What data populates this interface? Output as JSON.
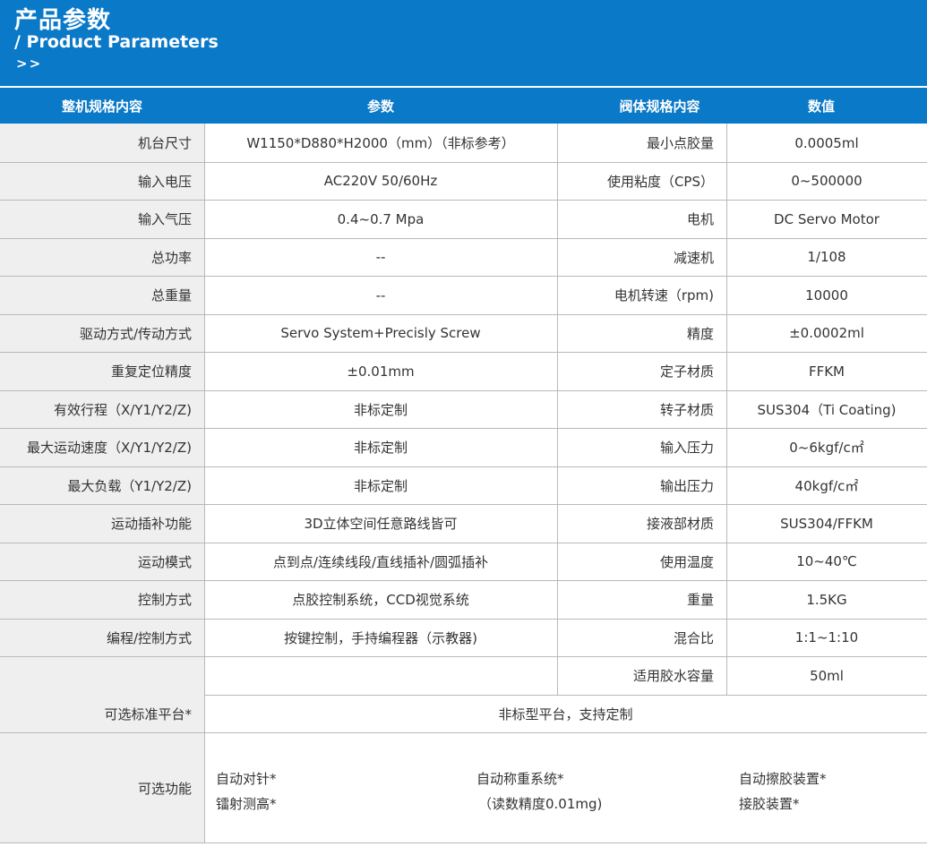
{
  "header": {
    "title_zh": "产品参数",
    "title_en": "/ Product Parameters",
    "arrows": ">>"
  },
  "table_header": {
    "col1": "整机规格内容",
    "col2": "参数",
    "col3": "阀体规格内容",
    "col4": "数值"
  },
  "rows": [
    {
      "label": "机台尺寸",
      "value": "W1150*D880*H2000（mm）（非标参考）",
      "valve_label": "最小点胶量",
      "valve_value": "0.0005ml"
    },
    {
      "label": "输入电压",
      "value": "AC220V 50/60Hz",
      "valve_label": "使用粘度（CPS）",
      "valve_value": "0~500000"
    },
    {
      "label": "输入气压",
      "value": "0.4~0.7 Mpa",
      "valve_label": "电机",
      "valve_value": "DC Servo Motor"
    },
    {
      "label": "总功率",
      "value": "--",
      "valve_label": "减速机",
      "valve_value": "1/108"
    },
    {
      "label": "总重量",
      "value": "--",
      "valve_label": "电机转速（rpm)",
      "valve_value": "10000"
    },
    {
      "label": "驱动方式/传动方式",
      "value": "Servo System+Precisly  Screw",
      "valve_label": "精度",
      "valve_value": "±0.0002ml"
    },
    {
      "label": "重复定位精度",
      "value": "±0.01mm",
      "valve_label": "定子材质",
      "valve_value": "FFKM"
    },
    {
      "label": "有效行程（X/Y1/Y2/Z)",
      "value": "非标定制",
      "valve_label": "转子材质",
      "valve_value": "SUS304（Ti Coating)"
    },
    {
      "label": "最大运动速度（X/Y1/Y2/Z)",
      "value": "非标定制",
      "valve_label": "输入压力",
      "valve_value": "0~6kgf/c㎡"
    },
    {
      "label": "最大负载（Y1/Y2/Z)",
      "value": "非标定制",
      "valve_label": "输出压力",
      "valve_value": "40kgf/c㎡"
    },
    {
      "label": "运动插补功能",
      "value": "3D立体空间任意路线皆可",
      "valve_label": "接液部材质",
      "valve_value": "SUS304/FFKM"
    },
    {
      "label": "运动模式",
      "value": "点到点/连续线段/直线插补/圆弧插补",
      "valve_label": "使用温度",
      "valve_value": "10~40℃"
    },
    {
      "label": "控制方式",
      "value": "点胶控制系统，CCD视觉系统",
      "valve_label": "重量",
      "valve_value": "1.5KG"
    },
    {
      "label": "编程/控制方式",
      "value": "按键控制，手持编程器（示教器)",
      "valve_label": "混合比",
      "valve_value": "1:1~1:10"
    },
    {
      "label": "",
      "value": "",
      "valve_label": "适用胶水容量",
      "valve_value": "50ml"
    }
  ],
  "platform": {
    "label": "可选标准平台*",
    "value": "非标型平台，支持定制"
  },
  "functions": {
    "label": "可选功能",
    "items": [
      {
        "line1": "自动对针*",
        "line2": "镭射测高*"
      },
      {
        "line1": "自动称重系统*",
        "line2": "（读数精度0.01mg)"
      },
      {
        "line1": "自动擦胶装置*",
        "line2": "接胶装置*"
      }
    ]
  },
  "colors": {
    "brand_blue": "#0a79c8",
    "label_bg": "#efefef",
    "line": "#b9b9b9"
  }
}
